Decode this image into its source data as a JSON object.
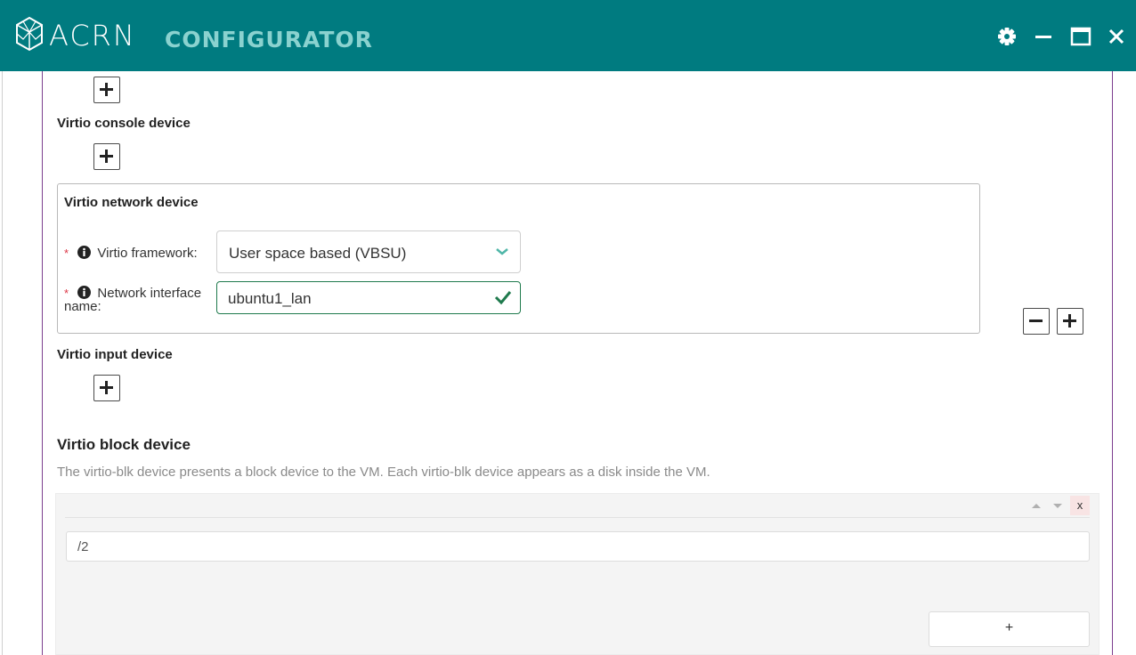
{
  "app": {
    "brand_main": "ACRN",
    "brand_sub": "CONFIGURATOR",
    "colors": {
      "titlebar": "#007b80",
      "brand_sub": "#8ad2cf",
      "valid": "#1f7a4d",
      "required": "#dc3545",
      "frame_accent": "#7c3f8f"
    },
    "window_controls": [
      "gear-icon",
      "minimize-icon",
      "maximize-icon",
      "close-icon"
    ]
  },
  "sections": {
    "virtio_console": {
      "label": "Virtio console device"
    },
    "virtio_network": {
      "label": "Virtio network device",
      "framework_label": "Virtio framework:",
      "framework_value": "User space based (VBSU)",
      "iface_label_line1": "Network interface",
      "iface_label_line2": "name:",
      "iface_value": "ubuntu1_lan",
      "required_mark": "*"
    },
    "virtio_input": {
      "label": "Virtio input device"
    },
    "virtio_block": {
      "title": "Virtio block device",
      "description": "The virtio-blk device presents a block device to the VM. Each virtio-blk device appears as a disk inside the VM.",
      "items": [
        "/2"
      ],
      "delete_label": "x",
      "add_label": "+"
    }
  }
}
